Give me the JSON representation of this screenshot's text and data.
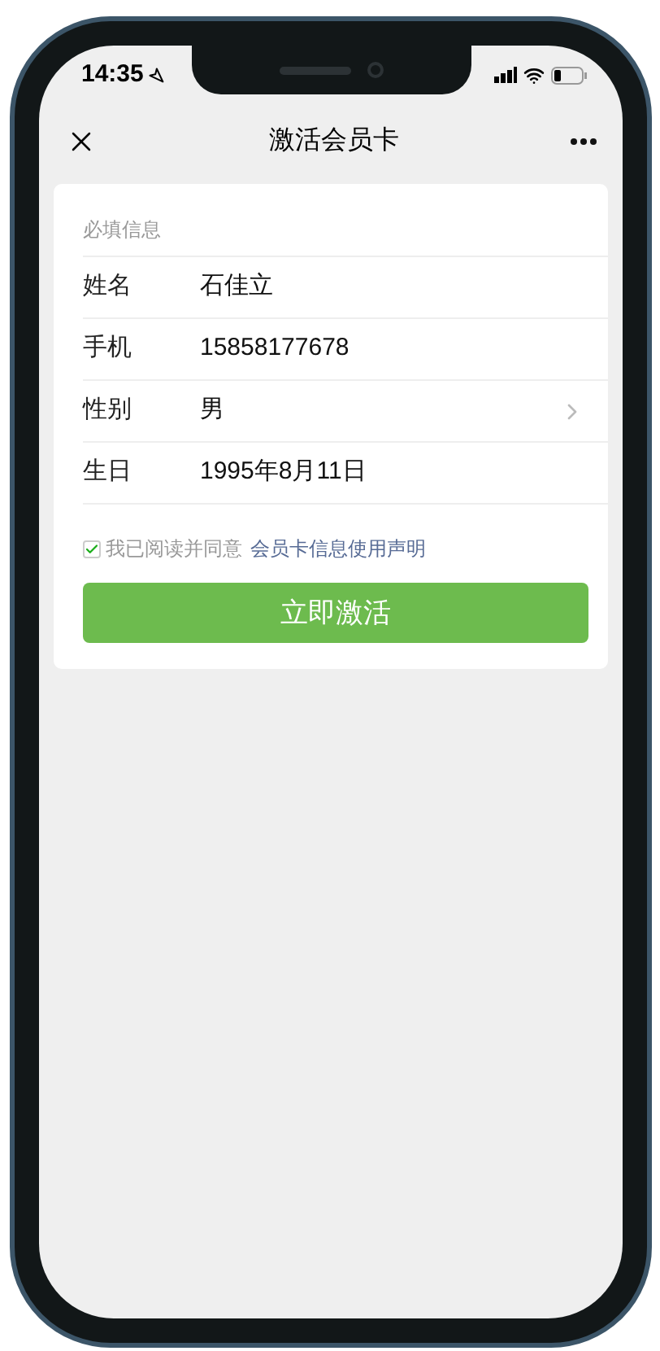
{
  "status_bar": {
    "time": "14:35"
  },
  "nav": {
    "title": "激活会员卡"
  },
  "form": {
    "section_title": "必填信息",
    "fields": [
      {
        "label": "姓名",
        "value": "石佳立",
        "kind": "text"
      },
      {
        "label": "手机",
        "value": "15858177678",
        "kind": "text"
      },
      {
        "label": "性别",
        "value": "男",
        "kind": "select"
      },
      {
        "label": "生日",
        "value": "1995年8月11日",
        "kind": "text"
      }
    ],
    "agreement": {
      "checked": true,
      "text": "我已阅读并同意",
      "link": "会员卡信息使用声明"
    },
    "submit": "立即激活"
  }
}
